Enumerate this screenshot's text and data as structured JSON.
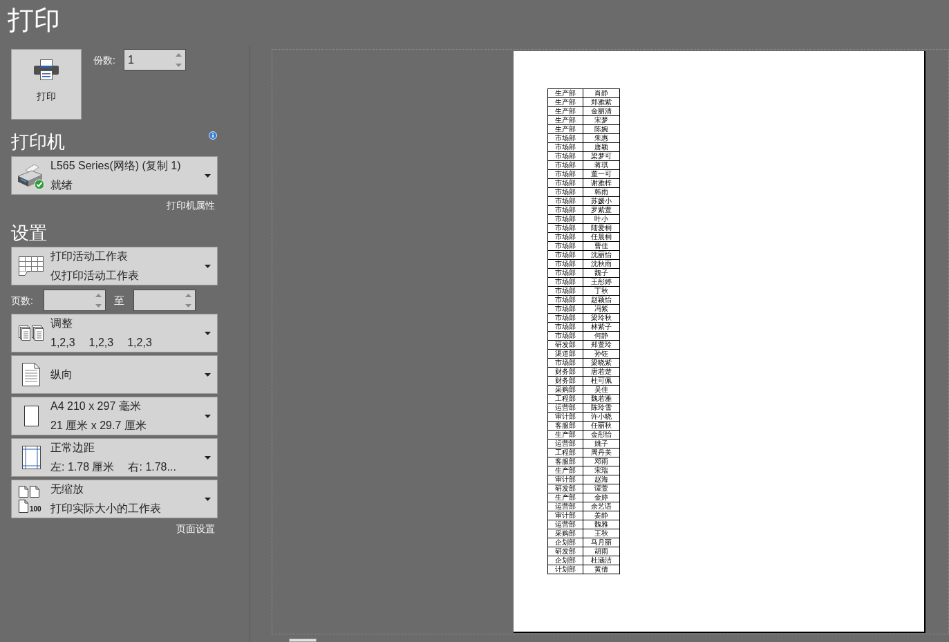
{
  "title": "打印",
  "print_button": {
    "label": "打印"
  },
  "copies": {
    "label": "份数:",
    "value": "1"
  },
  "printer": {
    "heading": "打印机",
    "name": "L565 Series(网络) (复制 1)",
    "status": "就绪",
    "properties_link": "打印机属性"
  },
  "settings": {
    "heading": "设置",
    "items": [
      {
        "kind": "sheets",
        "title": "打印活动工作表",
        "subtitle": [
          "仅打印活动工作表"
        ]
      },
      {
        "kind": "page-range",
        "label": "页数:",
        "to_label": "至"
      },
      {
        "kind": "collate",
        "title": "调整",
        "subtitle": [
          "1,2,3",
          "1,2,3",
          "1,2,3"
        ]
      },
      {
        "kind": "orientation",
        "title": "纵向"
      },
      {
        "kind": "paper",
        "title": "A4 210 x 297 毫米",
        "subtitle": [
          "21 厘米 x 29.7 厘米"
        ]
      },
      {
        "kind": "margins",
        "title": "正常边距",
        "subtitle": [
          "左: 1.78 厘米",
          "右: 1.78..."
        ]
      },
      {
        "kind": "scaling",
        "title": "无缩放",
        "icon_label": "100",
        "subtitle": [
          "打印实际大小的工作表"
        ]
      }
    ],
    "page_setup_link": "页面设置"
  },
  "preview": {
    "table": {
      "rows": [
        [
          "生产部",
          "肖静"
        ],
        [
          "生产部",
          "郑雅紫"
        ],
        [
          "生产部",
          "金丽清"
        ],
        [
          "生产部",
          "宋梦"
        ],
        [
          "生产部",
          "陈婉"
        ],
        [
          "市场部",
          "朱惠"
        ],
        [
          "市场部",
          "唐颖"
        ],
        [
          "市场部",
          "梁梦可"
        ],
        [
          "市场部",
          "蒋琪"
        ],
        [
          "市场部",
          "董一可"
        ],
        [
          "市场部",
          "谢雅梓"
        ],
        [
          "市场部",
          "韩雨"
        ],
        [
          "市场部",
          "苏媛小"
        ],
        [
          "市场部",
          "罗紫萱"
        ],
        [
          "市场部",
          "叶小"
        ],
        [
          "市场部",
          "陆爱桐"
        ],
        [
          "市场部",
          "任晨桐"
        ],
        [
          "市场部",
          "曹佳"
        ],
        [
          "市场部",
          "沈丽怡"
        ],
        [
          "市场部",
          "沈秋雨"
        ],
        [
          "市场部",
          "魏子"
        ],
        [
          "市场部",
          "王彤婷"
        ],
        [
          "市场部",
          "丁秋"
        ],
        [
          "市场部",
          "赵颖怡"
        ],
        [
          "市场部",
          "冯紫"
        ],
        [
          "市场部",
          "梁玲秋"
        ],
        [
          "市场部",
          "林紫子"
        ],
        [
          "市场部",
          "何静"
        ],
        [
          "研发部",
          "郑萱玲"
        ],
        [
          "渠道部",
          "孙钰"
        ],
        [
          "市场部",
          "梁晓紫"
        ],
        [
          "财务部",
          "唐若楚"
        ],
        [
          "财务部",
          "杜可佩"
        ],
        [
          "采购部",
          "吴佳"
        ],
        [
          "工程部",
          "魏若雅"
        ],
        [
          "运营部",
          "陈玲雪"
        ],
        [
          "审计部",
          "许小晓"
        ],
        [
          "客服部",
          "任丽秋"
        ],
        [
          "生产部",
          "金彤怡"
        ],
        [
          "运营部",
          "姚子"
        ],
        [
          "工程部",
          "周丹美"
        ],
        [
          "客服部",
          "邓雨"
        ],
        [
          "生产部",
          "宋瑞"
        ],
        [
          "审计部",
          "赵海"
        ],
        [
          "研发部",
          "谭萱"
        ],
        [
          "生产部",
          "金婷"
        ],
        [
          "运营部",
          "余艺语"
        ],
        [
          "审计部",
          "姜静"
        ],
        [
          "运营部",
          "魏雅"
        ],
        [
          "采购部",
          "王秋"
        ],
        [
          "企划部",
          "马月丽"
        ],
        [
          "研发部",
          "胡雨"
        ],
        [
          "企划部",
          "杜涵洁"
        ],
        [
          "计划部",
          "黄倩"
        ]
      ]
    }
  }
}
